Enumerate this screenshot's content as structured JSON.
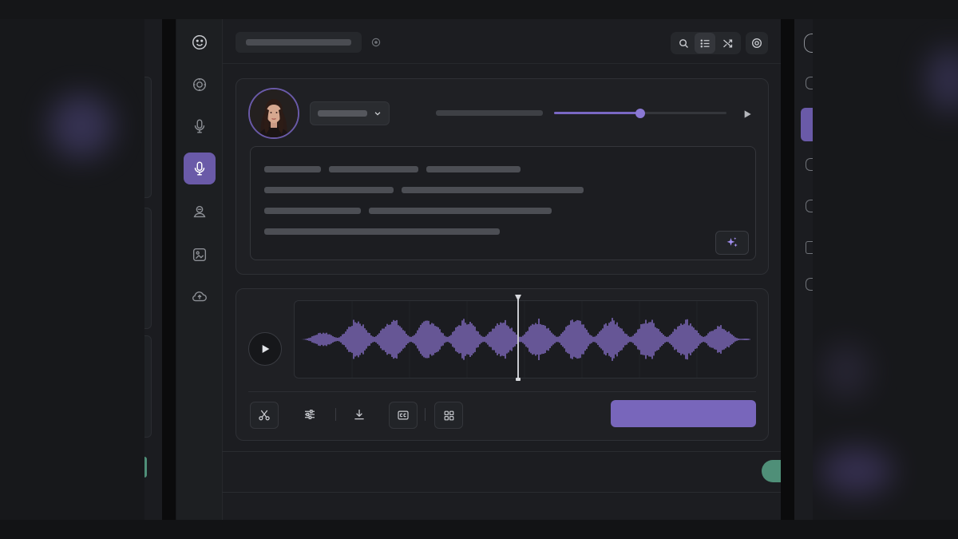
{
  "app": {
    "title": "",
    "colors": {
      "accent": "#6a5aa8",
      "accent_button": "#7866bb",
      "toggle_on": "#4f8f78",
      "background": "#1c1d21"
    }
  },
  "sidebar": {
    "items": [
      {
        "icon": "smiley-icon",
        "active": false
      },
      {
        "icon": "compass-icon",
        "active": false
      },
      {
        "icon": "microphone-icon",
        "active": false
      },
      {
        "icon": "microphone-icon",
        "active": true
      },
      {
        "icon": "voice-user-icon",
        "active": false
      },
      {
        "icon": "image-edit-icon",
        "active": false
      },
      {
        "icon": "upload-cloud-icon",
        "active": false
      }
    ]
  },
  "topbar": {
    "icons": [
      "search-icon",
      "list-icon",
      "shuffle-icon",
      "settings-icon"
    ]
  },
  "voice_panel": {
    "speed_fraction": 0.5,
    "icons": [
      "chevron-down-icon",
      "play-icon",
      "sparkle-icon"
    ]
  },
  "audio_panel": {
    "playhead_fraction": 0.49,
    "tools": [
      "scissors-icon",
      "sliders-icon",
      "download-icon",
      "caption-icon",
      "grid-icon"
    ]
  },
  "footer": {
    "toggle_on": true
  }
}
